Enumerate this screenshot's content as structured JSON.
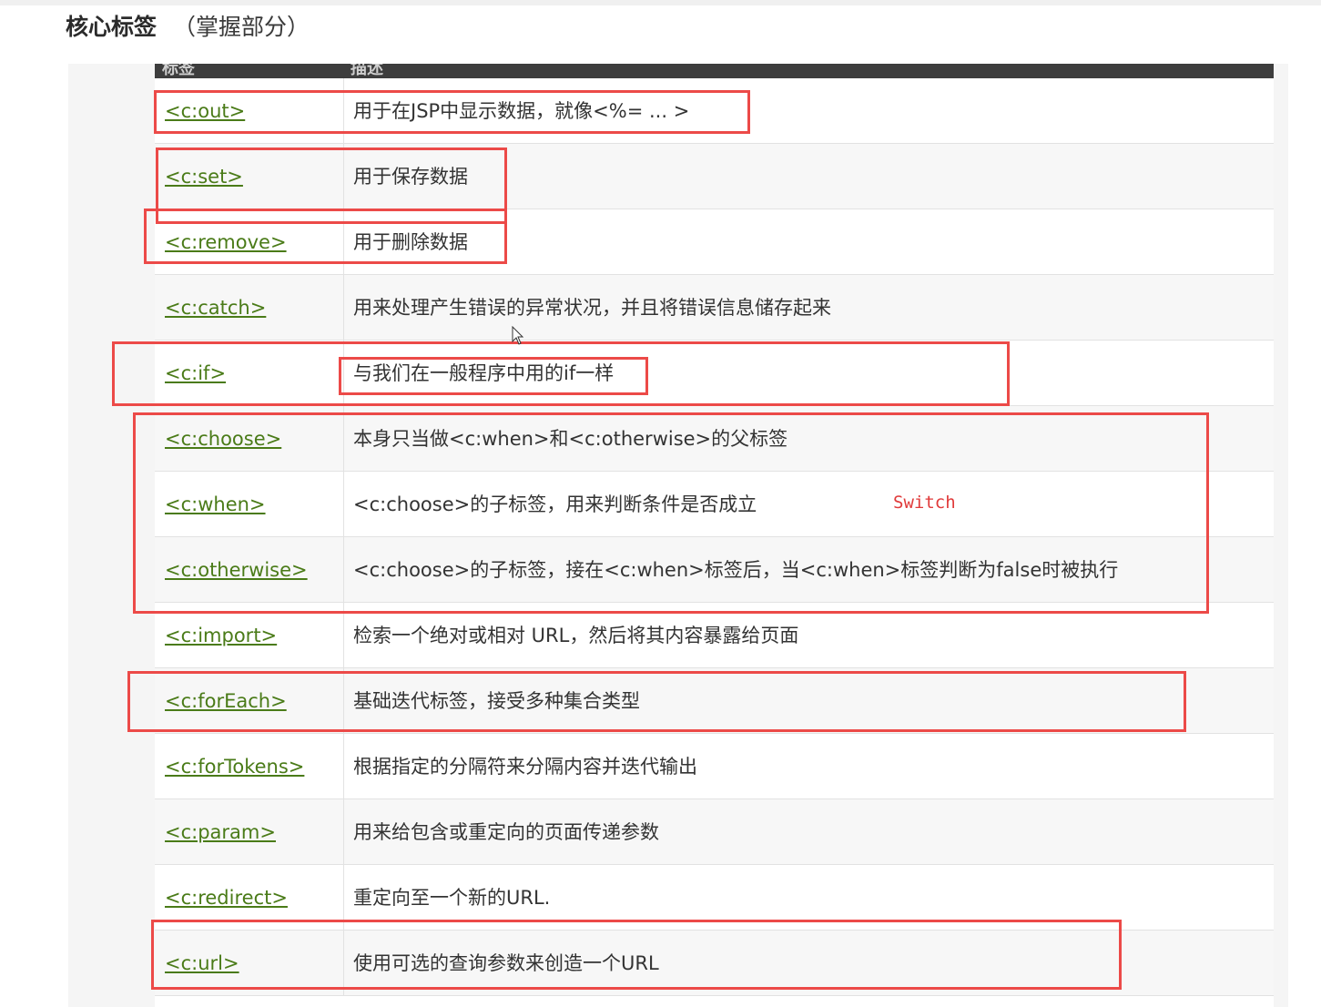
{
  "page": {
    "title": "核心标签",
    "subtitle": "（掌握部分）"
  },
  "table": {
    "columns": [
      "标签",
      "描述"
    ],
    "rows": [
      {
        "tag": "<c:out>",
        "desc": "用于在JSP中显示数据，就像<%= ... >"
      },
      {
        "tag": "<c:set>",
        "desc": "用于保存数据"
      },
      {
        "tag": "<c:remove>",
        "desc": "用于删除数据"
      },
      {
        "tag": "<c:catch>",
        "desc": "用来处理产生错误的异常状况，并且将错误信息储存起来"
      },
      {
        "tag": "<c:if>",
        "desc": "与我们在一般程序中用的if一样"
      },
      {
        "tag": "<c:choose>",
        "desc": "本身只当做<c:when>和<c:otherwise>的父标签"
      },
      {
        "tag": "<c:when>",
        "desc": "<c:choose>的子标签，用来判断条件是否成立"
      },
      {
        "tag": "<c:otherwise>",
        "desc": "<c:choose>的子标签，接在<c:when>标签后，当<c:when>标签判断为false时被执行"
      },
      {
        "tag": "<c:import>",
        "desc": "检索一个绝对或相对 URL，然后将其内容暴露给页面"
      },
      {
        "tag": "<c:forEach>",
        "desc": "基础迭代标签，接受多种集合类型"
      },
      {
        "tag": "<c:forTokens>",
        "desc": "根据指定的分隔符来分隔内容并迭代输出"
      },
      {
        "tag": "<c:param>",
        "desc": "用来给包含或重定向的页面传递参数"
      },
      {
        "tag": "<c:redirect>",
        "desc": "重定向至一个新的URL."
      },
      {
        "tag": "<c:url>",
        "desc": "使用可选的查询参数来创造一个URL"
      }
    ]
  },
  "annotations": {
    "switch_note": "Switch",
    "highlight_color": "#ec4a48"
  },
  "colors": {
    "link": "#4a7b18",
    "header_bg": "#3d3d3d"
  },
  "icons": {
    "cursor": "mouse-pointer-icon"
  }
}
